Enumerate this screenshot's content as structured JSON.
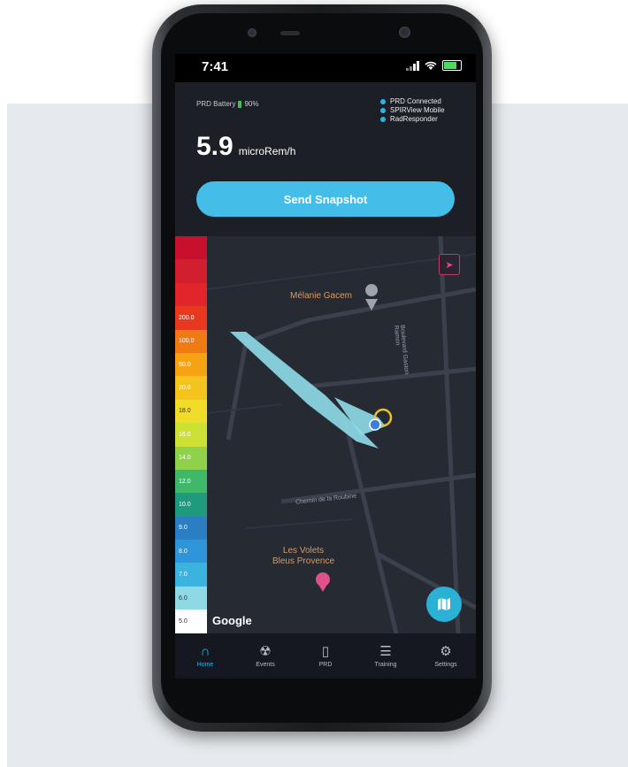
{
  "status_bar": {
    "time": "7:41"
  },
  "header": {
    "battery_label": "PRD Battery",
    "battery_percent": "90%",
    "connections": [
      "PRD Connected",
      "SPIRView Mobile",
      "RadResponder"
    ],
    "reading_value": "5.9",
    "reading_unit": "microRem/h",
    "snapshot_label": "Send Snapshot"
  },
  "scale": {
    "levels": [
      {
        "label": "",
        "color": "#c8102e"
      },
      {
        "label": "",
        "color": "#d21f2f"
      },
      {
        "label": "",
        "color": "#e0262b"
      },
      {
        "label": "200.0",
        "color": "#e8391f"
      },
      {
        "label": "100.0",
        "color": "#f07a14"
      },
      {
        "label": "50.0",
        "color": "#f5a312"
      },
      {
        "label": "20.0",
        "color": "#f5c41c"
      },
      {
        "label": "18.0",
        "color": "#f2dc2a"
      },
      {
        "label": "16.0",
        "color": "#cde034"
      },
      {
        "label": "14.0",
        "color": "#8fd149"
      },
      {
        "label": "12.0",
        "color": "#3fb86a"
      },
      {
        "label": "10.0",
        "color": "#1f9a7d"
      },
      {
        "label": "9.0",
        "color": "#2b7ec4"
      },
      {
        "label": "8.0",
        "color": "#2d95d8"
      },
      {
        "label": "7.0",
        "color": "#3ab3de"
      },
      {
        "label": "6.0",
        "color": "#8fd8e6"
      },
      {
        "label": "5.0",
        "color": "#ffffff"
      }
    ]
  },
  "map": {
    "poi_top": "Mélanie Gacem",
    "poi_bottom_line1": "Les Volets",
    "poi_bottom_line2": "Bleus Provence",
    "street_1": "Chemin de la Roubine",
    "street_2": "Boulevard Gaston Ramon",
    "google_label": "Google"
  },
  "tabs": [
    {
      "label": "Home",
      "icon": "home-icon",
      "active": true
    },
    {
      "label": "Events",
      "icon": "radiation-icon",
      "active": false
    },
    {
      "label": "PRD",
      "icon": "device-icon",
      "active": false
    },
    {
      "label": "Training",
      "icon": "list-icon",
      "active": false
    },
    {
      "label": "Settings",
      "icon": "gear-icon",
      "active": false
    }
  ]
}
